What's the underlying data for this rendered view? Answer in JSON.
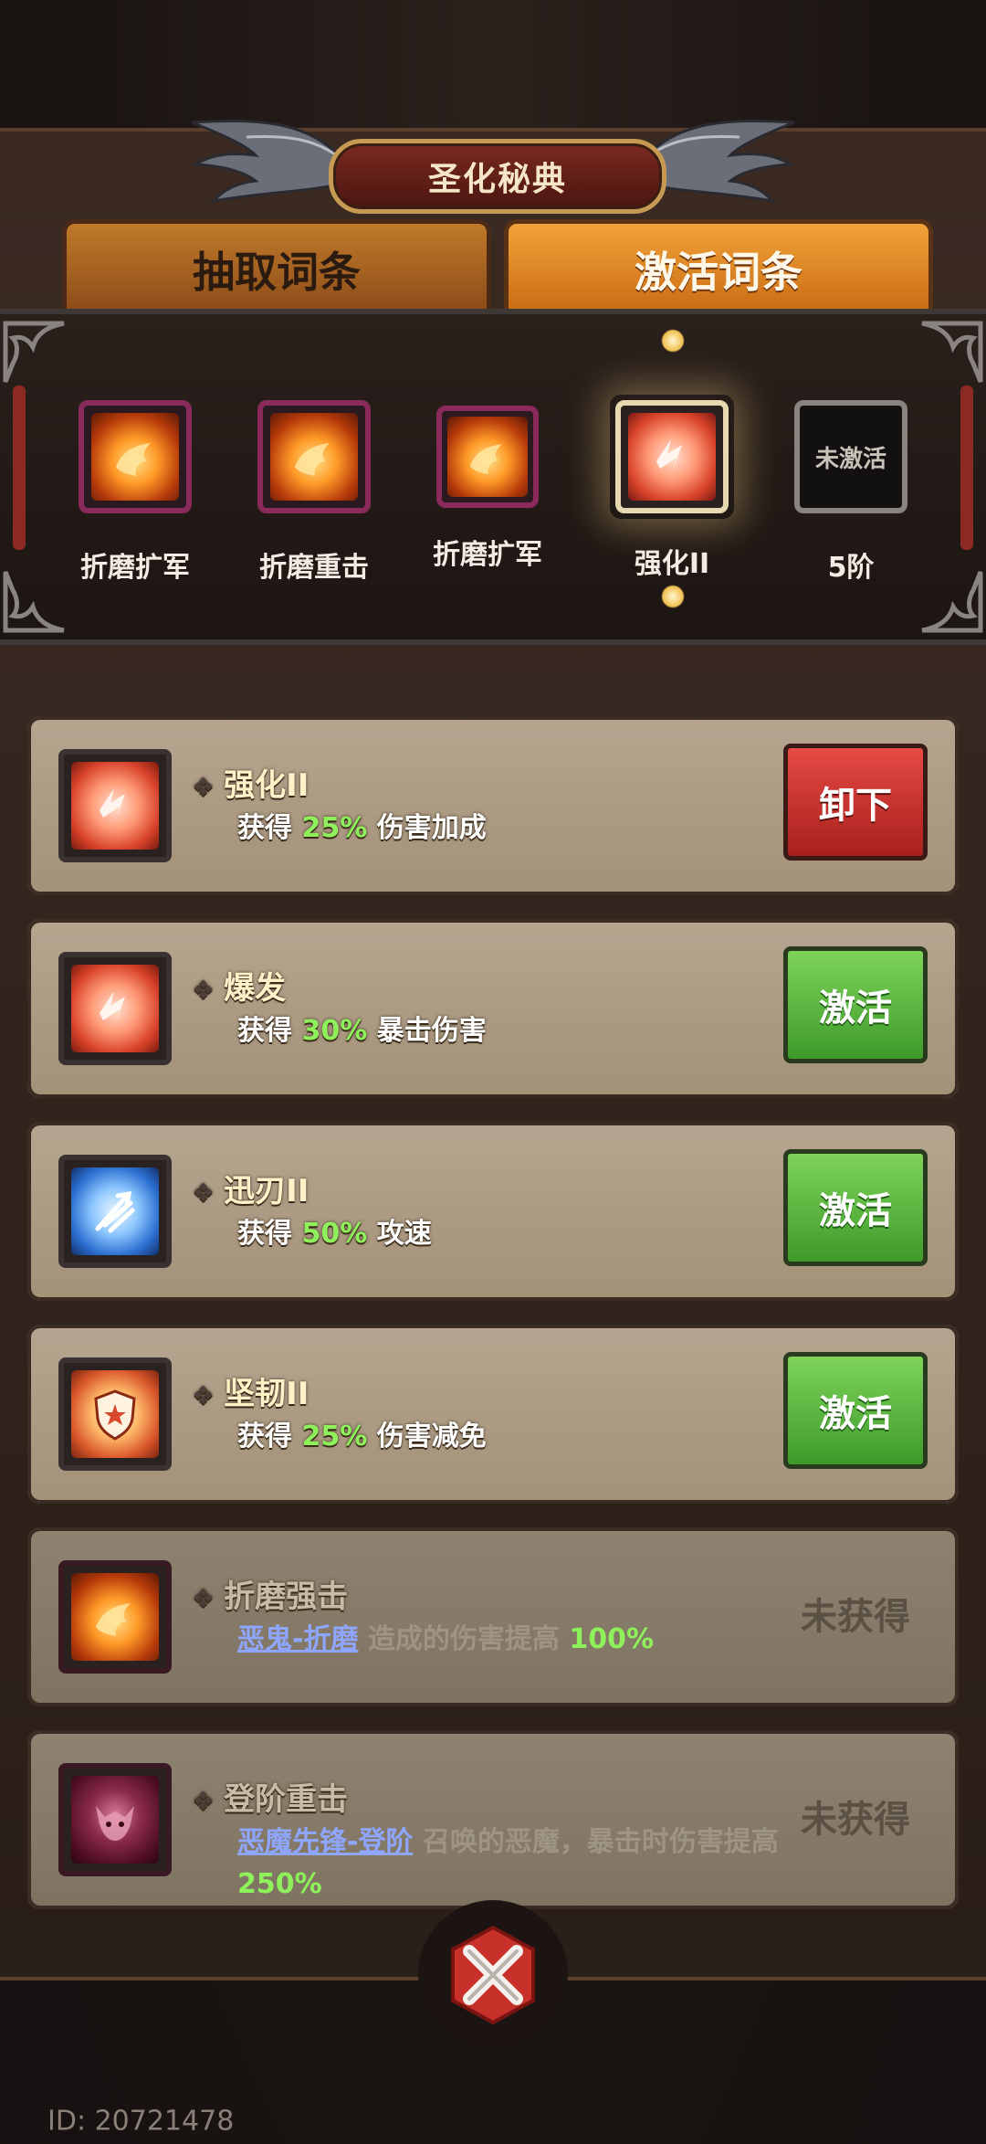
{
  "title": "圣化秘典",
  "tabs": [
    {
      "label": "抽取词条",
      "active": false
    },
    {
      "label": "激活词条",
      "active": true
    }
  ],
  "equipped_slots": [
    {
      "label": "折磨扩军",
      "icon": "fire-icon"
    },
    {
      "label": "折磨重击",
      "icon": "fire-icon"
    },
    {
      "label": "折磨扩军",
      "icon": "fire-icon"
    },
    {
      "label": "强化II",
      "icon": "power-icon"
    },
    {
      "label": "5阶",
      "icon": "locked-slot",
      "locked_text": "未激活"
    }
  ],
  "cards": [
    {
      "name": "强化II",
      "desc_prefix": "获得 ",
      "value": "25%",
      "desc_suffix": " 伤害加成",
      "button": "卸下",
      "icon": "power-icon"
    },
    {
      "name": "爆发",
      "desc_prefix": "获得 ",
      "value": "30%",
      "desc_suffix": " 暴击伤害",
      "button": "激活",
      "icon": "power-icon"
    },
    {
      "name": "迅刃II",
      "desc_prefix": "获得 ",
      "value": "50%",
      "desc_suffix": " 攻速",
      "button": "激活",
      "icon": "speed-icon"
    },
    {
      "name": "坚韧II",
      "desc_prefix": "获得 ",
      "value": "25%",
      "desc_suffix": " 伤害减免",
      "button": "激活",
      "icon": "shield-icon"
    },
    {
      "name": "折磨强击",
      "link": "恶鬼-折磨",
      "desc_mid": " 造成的伤害提高 ",
      "value": "100%",
      "status": "未获得",
      "icon": "fire-icon"
    },
    {
      "name": "登阶重击",
      "link": "恶魔先锋-登阶",
      "desc_mid": " 召唤的恶魔，暴击时伤害提高 ",
      "value": "250%",
      "status": "未获得",
      "icon": "demon-icon"
    }
  ],
  "footer": {
    "id": "ID: 20721478"
  },
  "colors": {
    "accent_green": "#8ef05a",
    "link_blue": "#8ea6ff",
    "button_green": "#4fb23a",
    "button_red": "#c8302a"
  }
}
